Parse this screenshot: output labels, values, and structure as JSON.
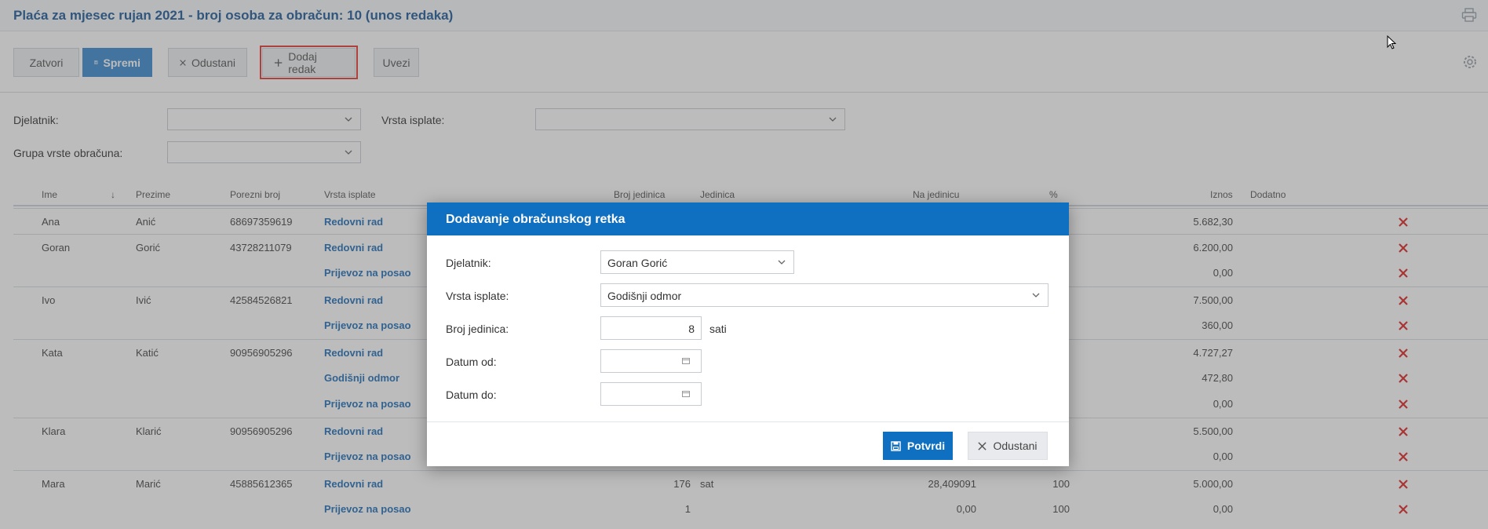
{
  "header": {
    "title": "Plaća za mjesec rujan 2021 - broj osoba za obračun: 10 (unos redaka)",
    "print_icon": "printer-icon"
  },
  "toolbar": {
    "close_label": "Zatvori",
    "save_label": "Spremi",
    "cancel_label": "Odustani",
    "add_row_label": "Dodaj redak",
    "import_label": "Uvezi",
    "settings_icon": "gear-icon"
  },
  "filters": {
    "employee_label": "Djelatnik:",
    "employee_value": "",
    "payment_type_label": "Vrsta isplate:",
    "payment_type_value": "",
    "calc_group_label": "Grupa vrste obračuna:",
    "calc_group_value": ""
  },
  "table": {
    "headers": {
      "first_name": "Ime",
      "sort_arrow": "↓",
      "last_name": "Prezime",
      "tax_number": "Porezni broj",
      "payment_type": "Vrsta isplate",
      "units": "Broj jedinica",
      "unit": "Jedinica",
      "per_unit": "Na jedinicu",
      "percent": "%",
      "amount": "Iznos",
      "extra": "Dodatno"
    },
    "rows": [
      {
        "first": "Ana",
        "last": "Anić",
        "tax": "68697359619",
        "type": "Redovni rad",
        "units": "",
        "unit": "",
        "per_unit": "",
        "pct": "",
        "amount": "5.682,30"
      },
      {
        "first": "Goran",
        "last": "Gorić",
        "tax": "43728211079",
        "type": "Redovni rad",
        "units": "",
        "unit": "",
        "per_unit": "",
        "pct": "",
        "amount": "6.200,00"
      },
      {
        "first": "",
        "last": "",
        "tax": "",
        "type": "Prijevoz na posao",
        "units": "",
        "unit": "",
        "per_unit": "",
        "pct": "",
        "amount": "0,00"
      },
      {
        "first": "Ivo",
        "last": "Ivić",
        "tax": "42584526821",
        "type": "Redovni rad",
        "units": "",
        "unit": "",
        "per_unit": "",
        "pct": "",
        "amount": "7.500,00"
      },
      {
        "first": "",
        "last": "",
        "tax": "",
        "type": "Prijevoz na posao",
        "units": "",
        "unit": "",
        "per_unit": "",
        "pct": "",
        "amount": "360,00"
      },
      {
        "first": "Kata",
        "last": "Katić",
        "tax": "90956905296",
        "type": "Redovni rad",
        "units": "",
        "unit": "",
        "per_unit": "",
        "pct": "",
        "amount": "4.727,27"
      },
      {
        "first": "",
        "last": "",
        "tax": "",
        "type": "Godišnji odmor",
        "units": "",
        "unit": "",
        "per_unit": "",
        "pct": "",
        "amount": "472,80"
      },
      {
        "first": "",
        "last": "",
        "tax": "",
        "type": "Prijevoz na posao",
        "units": "",
        "unit": "",
        "per_unit": "",
        "pct": "",
        "amount": "0,00"
      },
      {
        "first": "Klara",
        "last": "Klarić",
        "tax": "90956905296",
        "type": "Redovni rad",
        "units": "",
        "unit": "",
        "per_unit": "",
        "pct": "",
        "amount": "5.500,00"
      },
      {
        "first": "",
        "last": "",
        "tax": "",
        "type": "Prijevoz na posao",
        "units": "",
        "unit": "",
        "per_unit": "",
        "pct": "",
        "amount": "0,00"
      },
      {
        "first": "Mara",
        "last": "Marić",
        "tax": "45885612365",
        "type": "Redovni rad",
        "units": "176",
        "unit": "sat",
        "per_unit": "28,409091",
        "pct": "100",
        "amount": "5.000,00"
      },
      {
        "first": "",
        "last": "",
        "tax": "",
        "type": "Prijevoz na posao",
        "units": "1",
        "unit": "",
        "per_unit": "0,00",
        "pct": "100",
        "amount": "0,00"
      }
    ]
  },
  "modal": {
    "title": "Dodavanje obračunskog retka",
    "employee_label": "Djelatnik:",
    "employee_value": "Goran Gorić",
    "payment_type_label": "Vrsta isplate:",
    "payment_type_value": "Godišnji odmor",
    "units_label": "Broj jedinica:",
    "units_value": "8",
    "units_suffix": "sati",
    "date_from_label": "Datum od:",
    "date_from_value": "",
    "date_to_label": "Datum do:",
    "date_to_value": "",
    "confirm_label": "Potvrdi",
    "cancel_label": "Odustani"
  },
  "colors": {
    "accent": "#0f6fc0",
    "link": "#1f6fb8",
    "delete": "#e02424",
    "highlight": "#e53935"
  }
}
